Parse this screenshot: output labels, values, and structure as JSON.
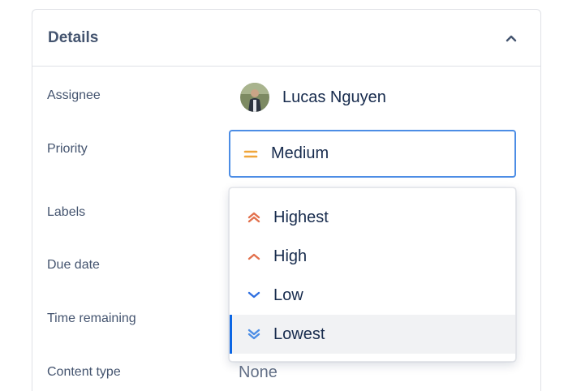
{
  "panel": {
    "title": "Details"
  },
  "fields": {
    "assignee_label": "Assignee",
    "priority_label": "Priority",
    "labels_label": "Labels",
    "due_date_label": "Due date",
    "time_remaining_label": "Time remaining",
    "content_type_label": "Content type"
  },
  "assignee": {
    "name": "Lucas Nguyen"
  },
  "priority": {
    "selected": "Medium",
    "options": [
      {
        "label": "Highest",
        "icon": "double-chevron-up-icon",
        "color": "#e2704c"
      },
      {
        "label": "High",
        "icon": "chevron-up-icon",
        "color": "#e2704c"
      },
      {
        "label": "Low",
        "icon": "chevron-down-icon",
        "color": "#2f6fe0"
      },
      {
        "label": "Lowest",
        "icon": "double-chevron-down-icon",
        "color": "#4c8de5"
      }
    ],
    "selected_icon": "equals-icon",
    "selected_color": "#f0a63a"
  },
  "content_type": {
    "value": "None"
  },
  "colors": {
    "focus_border": "#4c8de5",
    "active_option_bg": "#f1f2f4",
    "active_option_bar": "#0c66e4"
  }
}
